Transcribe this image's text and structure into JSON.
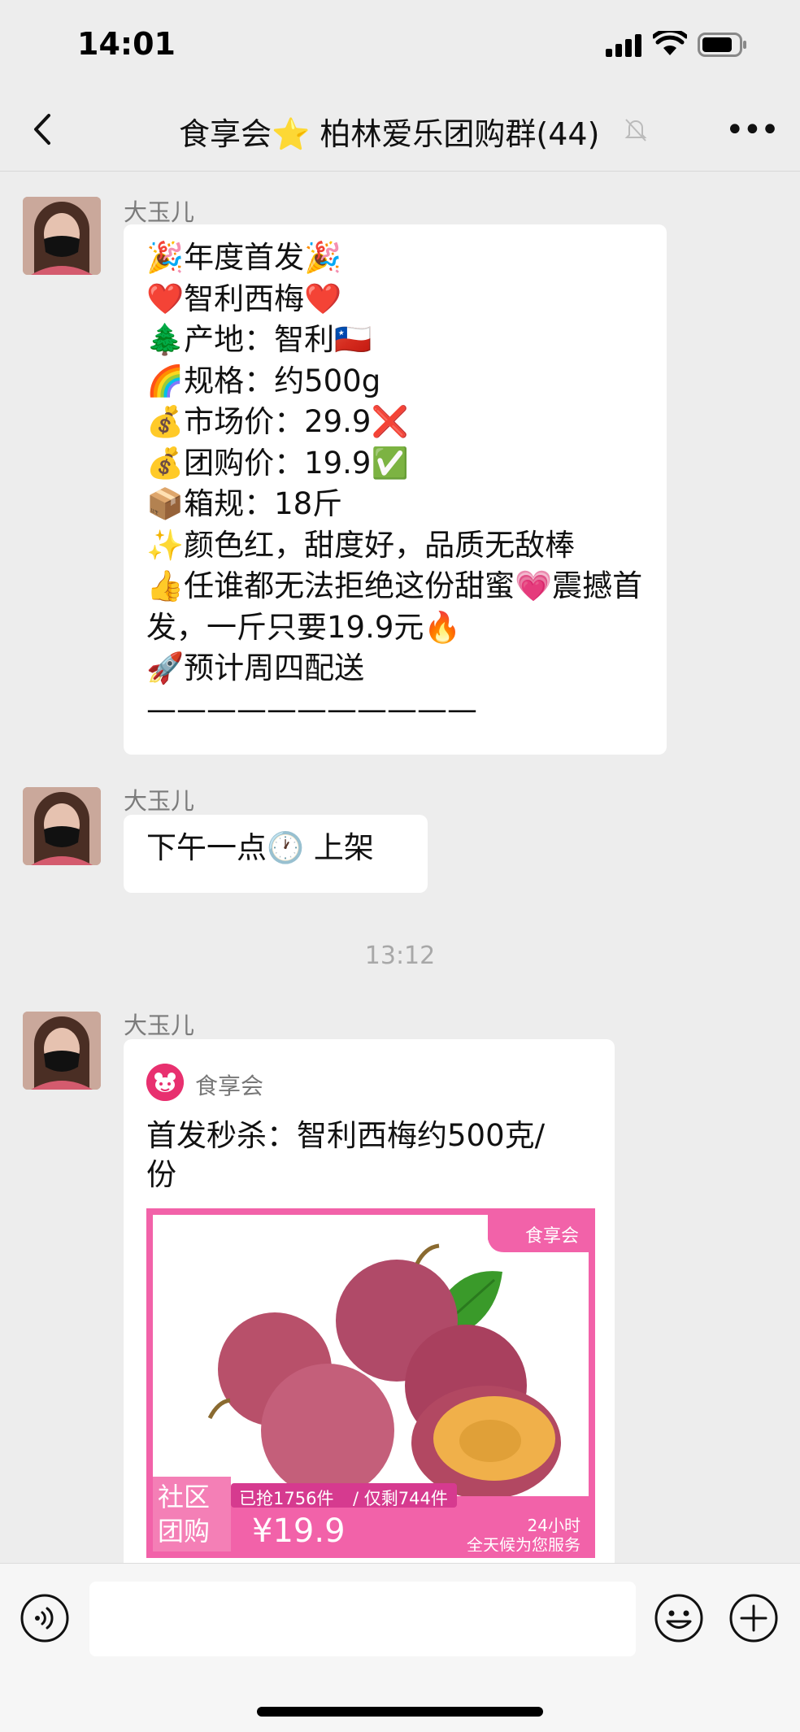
{
  "status_bar": {
    "time": "14:01"
  },
  "nav": {
    "title": "食享会⭐️ 柏林爱乐团购群(44)"
  },
  "messages": [
    {
      "sender": "大玉儿",
      "text": "🎉年度首发🎉\n❤️智利西梅❤️\n🌲产地：智利🇨🇱\n🌈规格：约500g\n💰市场价：29.9❌\n💰团购价：19.9✅\n📦箱规：18斤\n✨颜色红，甜度好，品质无敌棒\n👍任谁都无法拒绝这份甜蜜💗震撼首发，一斤只要19.9元🔥\n🚀预计周四配送\n———————————"
    },
    {
      "sender": "大玉儿",
      "text": "下午一点🕐 上架"
    }
  ],
  "timestamp": "13:12",
  "mini_program": {
    "sender": "大玉儿",
    "app_name": "食享会",
    "title": "首发秒杀：智利西梅约500克/份",
    "image": {
      "brand": "食享会",
      "badge": "社区\n团购",
      "sold": "已抢1756件",
      "remaining": "/ 仅剩744件",
      "price": "¥19.9",
      "service_line1": "24小时",
      "service_line2": "全天候为您服务"
    }
  },
  "colors": {
    "background": "#ededed",
    "bubble": "#ffffff",
    "accent": "#f262a9"
  }
}
